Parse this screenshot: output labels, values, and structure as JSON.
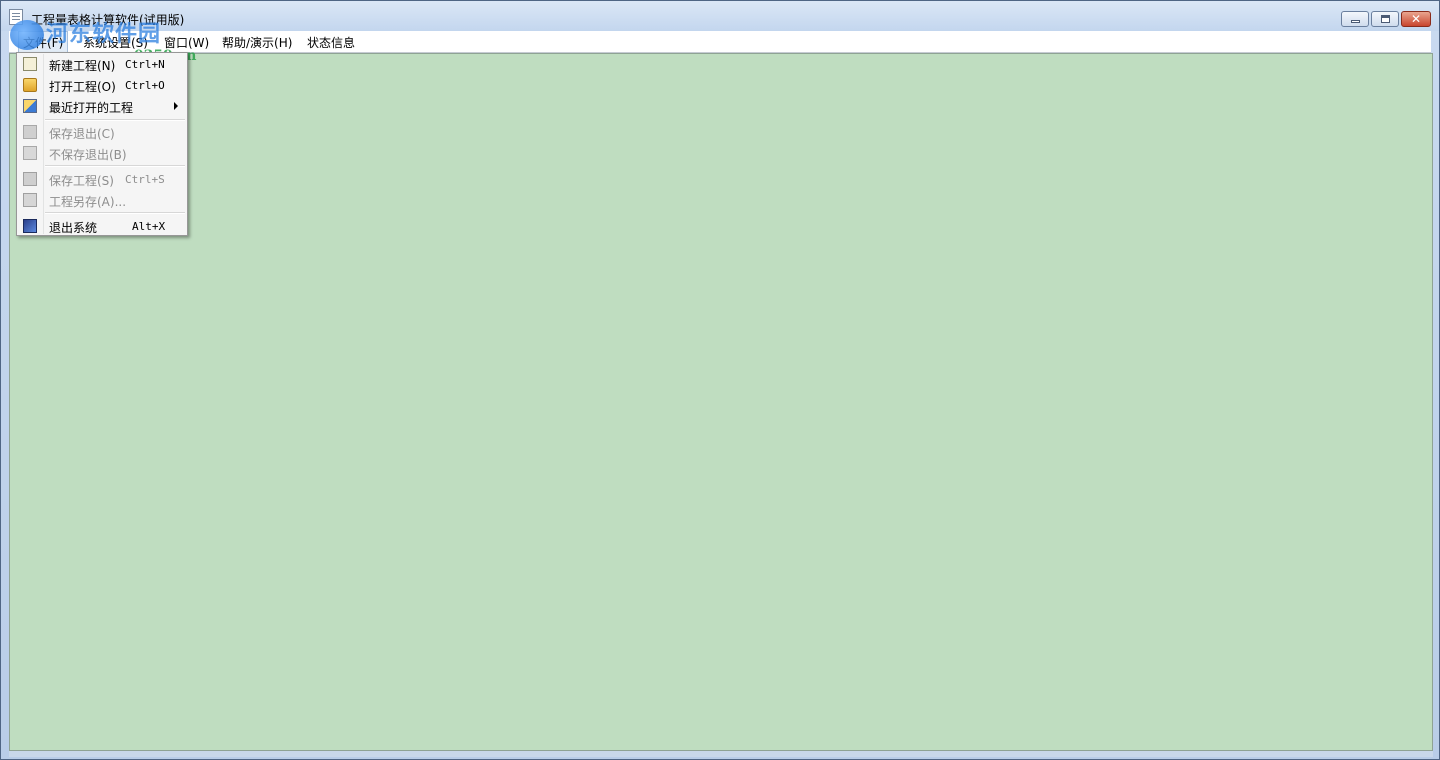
{
  "window": {
    "title": "工程量表格计算软件(试用版)",
    "close_glyph": "✕"
  },
  "watermark": {
    "site_name": "河东软件园",
    "url": "www.pc0359.cn"
  },
  "menubar": {
    "items": [
      {
        "label": "文件(F)"
      },
      {
        "label": "系统设置(S)"
      },
      {
        "label": "窗口(W)"
      },
      {
        "label": "帮助/演示(H)"
      },
      {
        "label": "状态信息"
      }
    ]
  },
  "file_menu": {
    "items": [
      {
        "label": "新建工程(N)",
        "shortcut": "Ctrl+N",
        "enabled": true,
        "icon": "new-project-icon"
      },
      {
        "label": "打开工程(O)",
        "shortcut": "Ctrl+O",
        "enabled": true,
        "icon": "open-folder-icon"
      },
      {
        "label": "最近打开的工程",
        "shortcut": "",
        "enabled": true,
        "icon": "recent-projects-icon",
        "submenu": true
      },
      {
        "label": "保存退出(C)",
        "shortcut": "",
        "enabled": false,
        "icon": "save-exit-icon"
      },
      {
        "label": "不保存退出(B)",
        "shortcut": "",
        "enabled": false,
        "icon": "discard-exit-icon"
      },
      {
        "label": "保存工程(S)",
        "shortcut": "Ctrl+S",
        "enabled": false,
        "icon": "save-icon"
      },
      {
        "label": "工程另存(A)...",
        "shortcut": "",
        "enabled": false,
        "icon": "save-as-icon"
      },
      {
        "label": "退出系统",
        "shortcut": "Alt+X",
        "enabled": true,
        "icon": "exit-system-icon"
      }
    ]
  },
  "colors": {
    "client_background": "#bfddc0",
    "title_gradient_top": "#dbe7f6",
    "close_button": "#c9452d"
  }
}
